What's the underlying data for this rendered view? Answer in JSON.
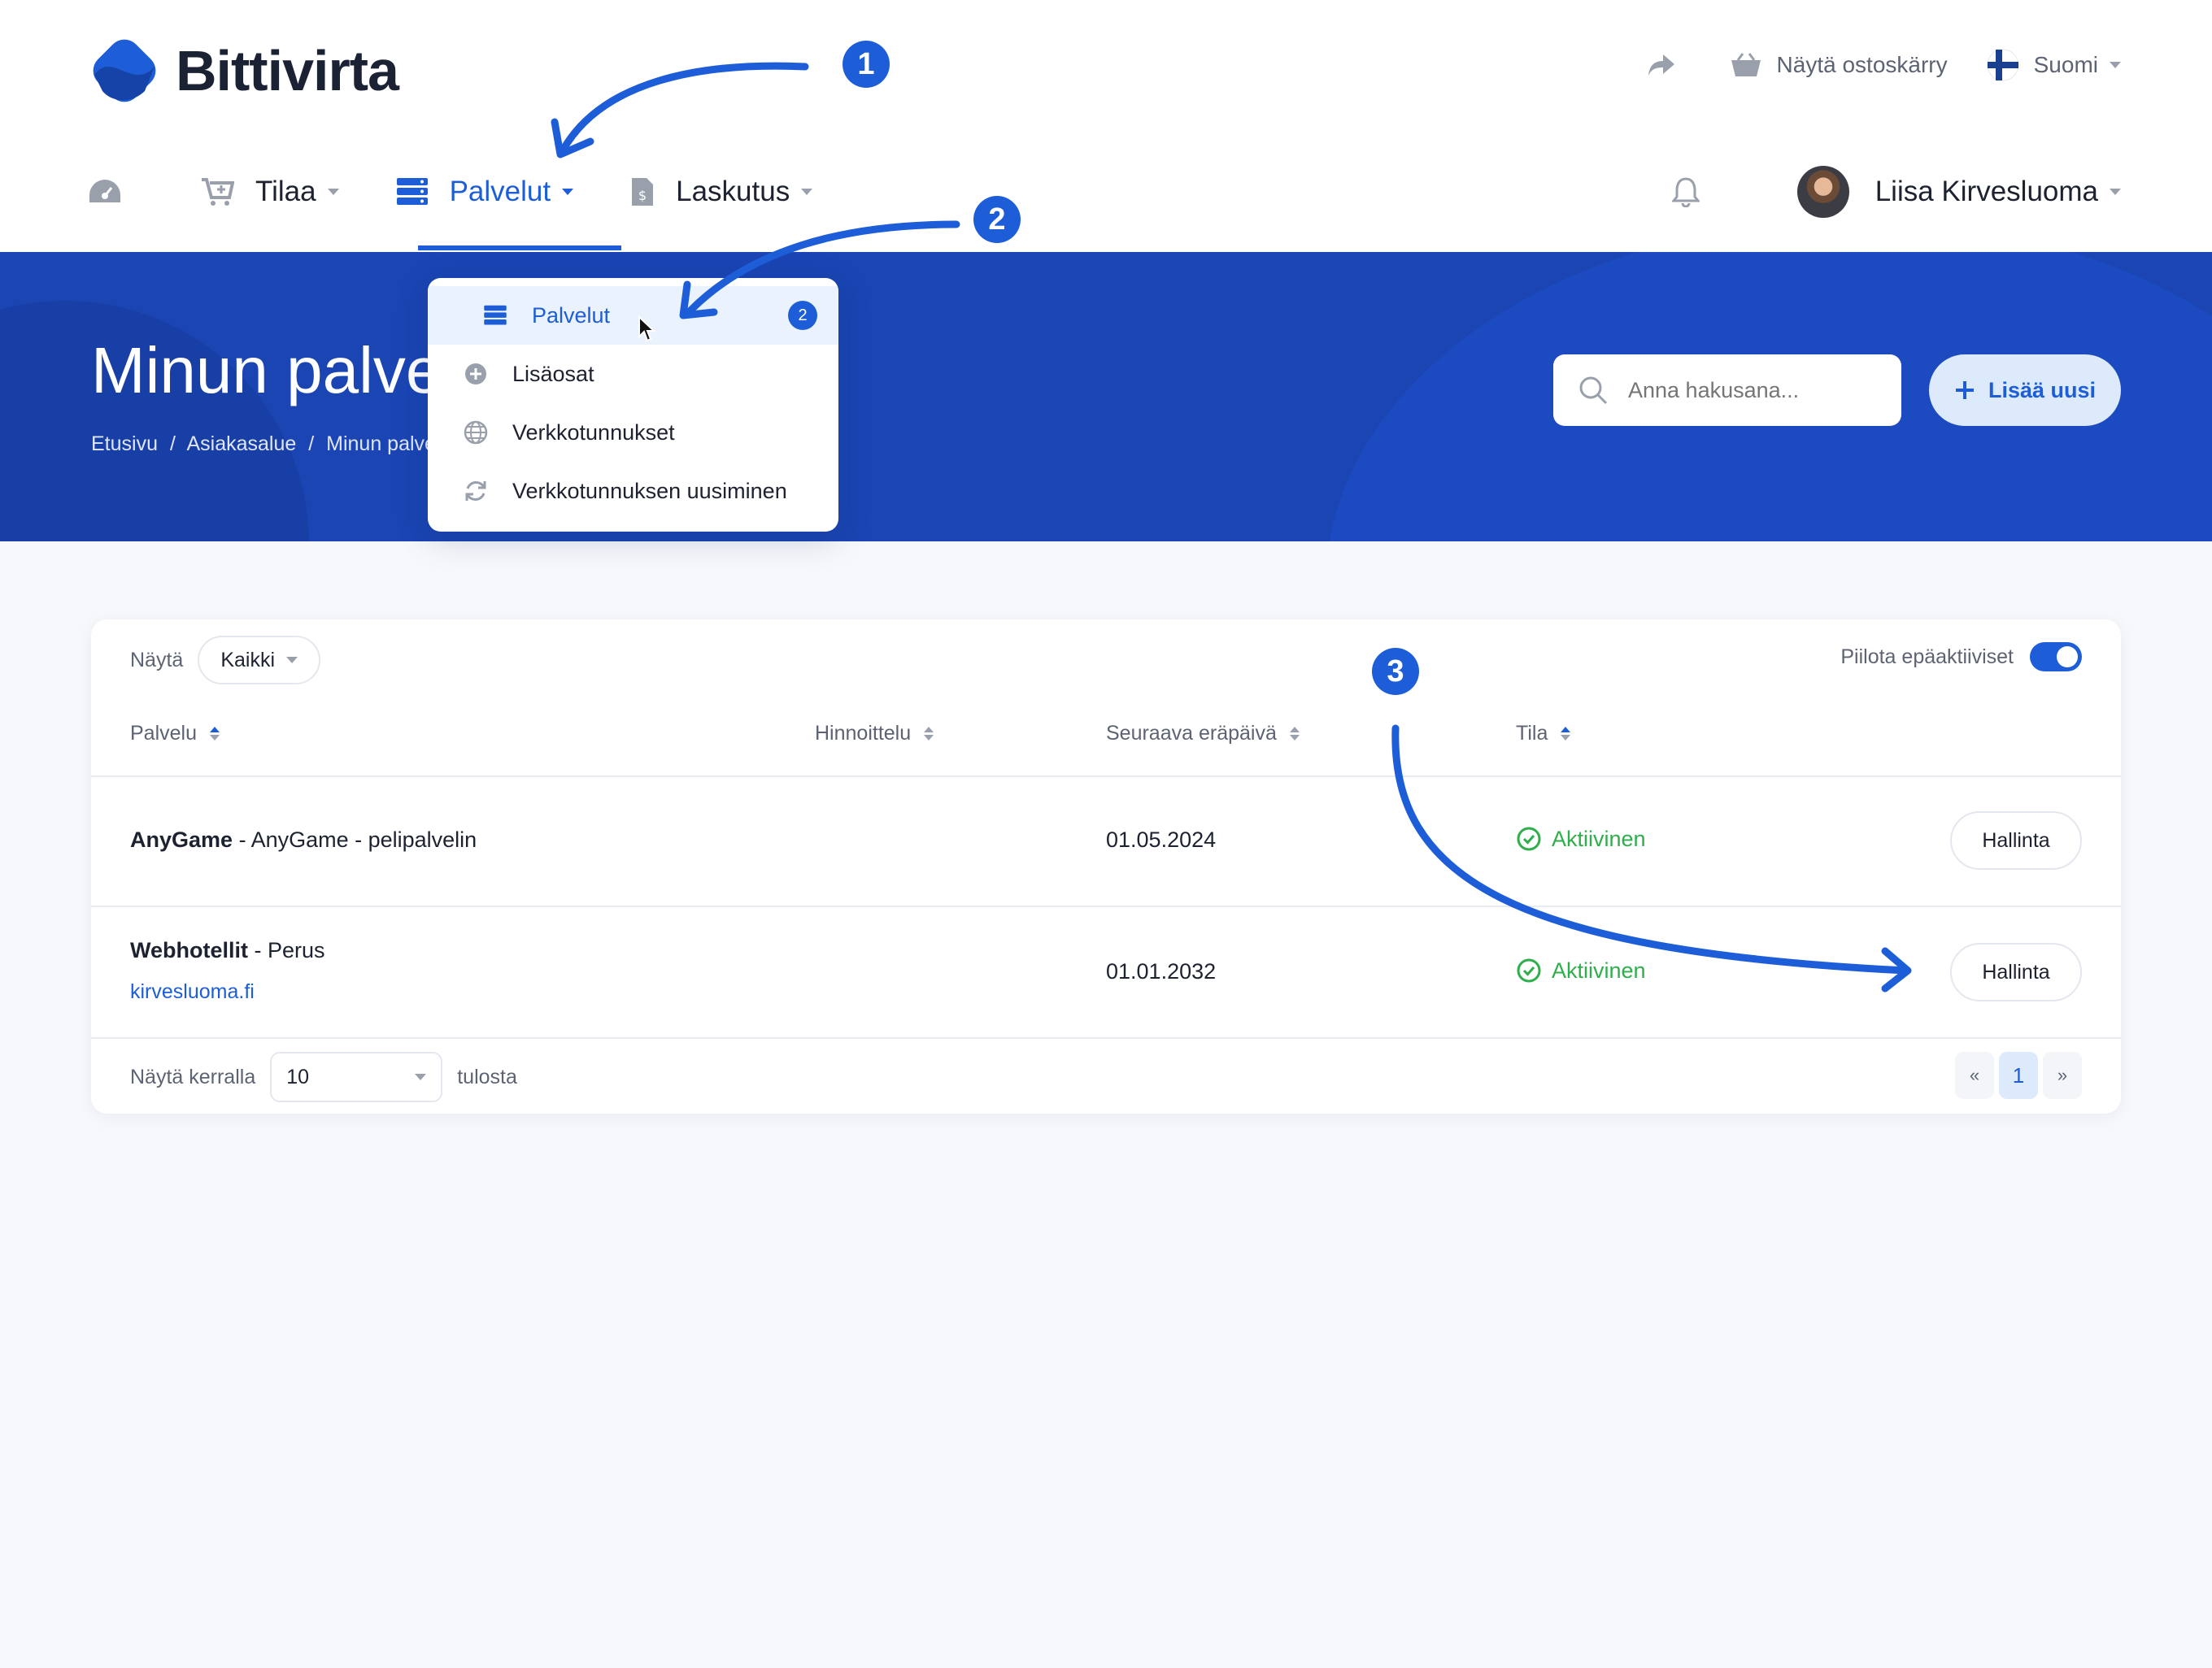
{
  "brand": {
    "name": "Bittivirta",
    "accent": "#1d5ed8",
    "hero_bg": "#1a45b3"
  },
  "topbar": {
    "cart_label": "Näytä ostoskärry",
    "language": "Suomi"
  },
  "nav": {
    "items": [
      {
        "label": "",
        "icon": "dashboard-icon"
      },
      {
        "label": "Tilaa",
        "icon": "cart-plus-icon"
      },
      {
        "label": "Palvelut",
        "icon": "server-icon",
        "active": true
      },
      {
        "label": "Laskutus",
        "icon": "invoice-icon"
      }
    ],
    "user_name": "Liisa Kirvesluoma"
  },
  "dropdown": {
    "items": [
      {
        "label": "Palvelut",
        "icon": "server-icon",
        "badge": "2",
        "active": true
      },
      {
        "label": "Lisäosat",
        "icon": "plus-circle-icon"
      },
      {
        "label": "Verkkotunnukset",
        "icon": "globe-icon"
      },
      {
        "label": "Verkkotunnuksen uusiminen",
        "icon": "refresh-icon"
      }
    ]
  },
  "hero": {
    "title": "Minun palvelut",
    "breadcrumb": [
      "Etusivu",
      "/",
      "Asiakasalue",
      "/",
      "Minun palvelut"
    ],
    "search_placeholder": "Anna hakusana...",
    "add_label": "Lisää uusi"
  },
  "table": {
    "filter_label": "Näytä",
    "filter_value": "Kaikki",
    "hide_inactive_label": "Piilota epäaktiiviset",
    "hide_inactive": true,
    "columns": [
      "Palvelu",
      "Hinnoittelu",
      "Seuraava eräpäivä",
      "Tila"
    ],
    "rows": [
      {
        "product": "AnyGame",
        "description": " - AnyGame - pelipalvelin",
        "domain": "",
        "pricing": "",
        "due": "01.05.2024",
        "status": "Aktiivinen",
        "action": "Hallinta"
      },
      {
        "product": "Webhotellit",
        "description": " - Perus",
        "domain": "kirvesluoma.fi",
        "pricing": "",
        "due": "01.01.2032",
        "status": "Aktiivinen",
        "action": "Hallinta"
      }
    ],
    "per_page_label": "Näytä kerralla",
    "per_page_value": "10",
    "per_page_suffix": "tulosta",
    "pagination": {
      "prev": "«",
      "current": "1",
      "next": "»"
    }
  },
  "annotations": {
    "step1": "1",
    "step2": "2",
    "step3": "3",
    "color": "#1d5ed8"
  }
}
